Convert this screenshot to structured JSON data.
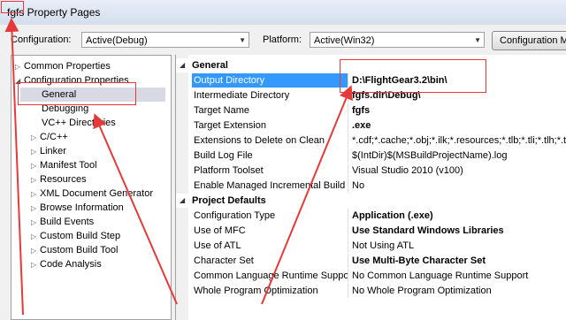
{
  "window": {
    "title": "fgfs Property Pages"
  },
  "toolbar": {
    "configuration_label": "Configuration:",
    "configuration_value": "Active(Debug)",
    "platform_label": "Platform:",
    "platform_value": "Active(Win32)",
    "config_manager_label": "Configuration M"
  },
  "tree": [
    {
      "label": "Common Properties",
      "expander": "▷"
    },
    {
      "label": "Configuration Properties",
      "expander": "◢"
    },
    {
      "label": "General",
      "expander": ""
    },
    {
      "label": "Debugging",
      "expander": ""
    },
    {
      "label": "VC++ Directories",
      "expander": ""
    },
    {
      "label": "C/C++",
      "expander": "▷"
    },
    {
      "label": "Linker",
      "expander": "▷"
    },
    {
      "label": "Manifest Tool",
      "expander": "▷"
    },
    {
      "label": "Resources",
      "expander": "▷"
    },
    {
      "label": "XML Document Generator",
      "expander": "▷"
    },
    {
      "label": "Browse Information",
      "expander": "▷"
    },
    {
      "label": "Build Events",
      "expander": "▷"
    },
    {
      "label": "Custom Build Step",
      "expander": "▷"
    },
    {
      "label": "Custom Build Tool",
      "expander": "▷"
    },
    {
      "label": "Code Analysis",
      "expander": "▷"
    }
  ],
  "grid": {
    "general": {
      "title": "General",
      "rows": [
        {
          "name": "Output Directory",
          "value": "D:\\FlightGear3.2\\bin\\"
        },
        {
          "name": "Intermediate Directory",
          "value": "fgfs.dir\\Debug\\"
        },
        {
          "name": "Target Name",
          "value": "fgfs"
        },
        {
          "name": "Target Extension",
          "value": ".exe"
        },
        {
          "name": "Extensions to Delete on Clean",
          "value": "*.cdf;*.cache;*.obj;*.ilk;*.resources;*.tlb;*.tli;*.tlh;*.tm"
        },
        {
          "name": "Build Log File",
          "value": "$(IntDir)$(MSBuildProjectName).log"
        },
        {
          "name": "Platform Toolset",
          "value": "Visual Studio 2010 (v100)"
        },
        {
          "name": "Enable Managed Incremental Build",
          "value": "No"
        }
      ]
    },
    "project_defaults": {
      "title": "Project Defaults",
      "rows": [
        {
          "name": "Configuration Type",
          "value": "Application (.exe)"
        },
        {
          "name": "Use of MFC",
          "value": "Use Standard Windows Libraries"
        },
        {
          "name": "Use of ATL",
          "value": "Not Using ATL"
        },
        {
          "name": "Character Set",
          "value": "Use Multi-Byte Character Set"
        },
        {
          "name": "Common Language Runtime Support",
          "value": "No Common Language Runtime Support"
        },
        {
          "name": "Whole Program Optimization",
          "value": "No Whole Program Optimization"
        }
      ]
    }
  },
  "colors": {
    "selection": "#3399ff",
    "annotation": "#e63a3a"
  }
}
